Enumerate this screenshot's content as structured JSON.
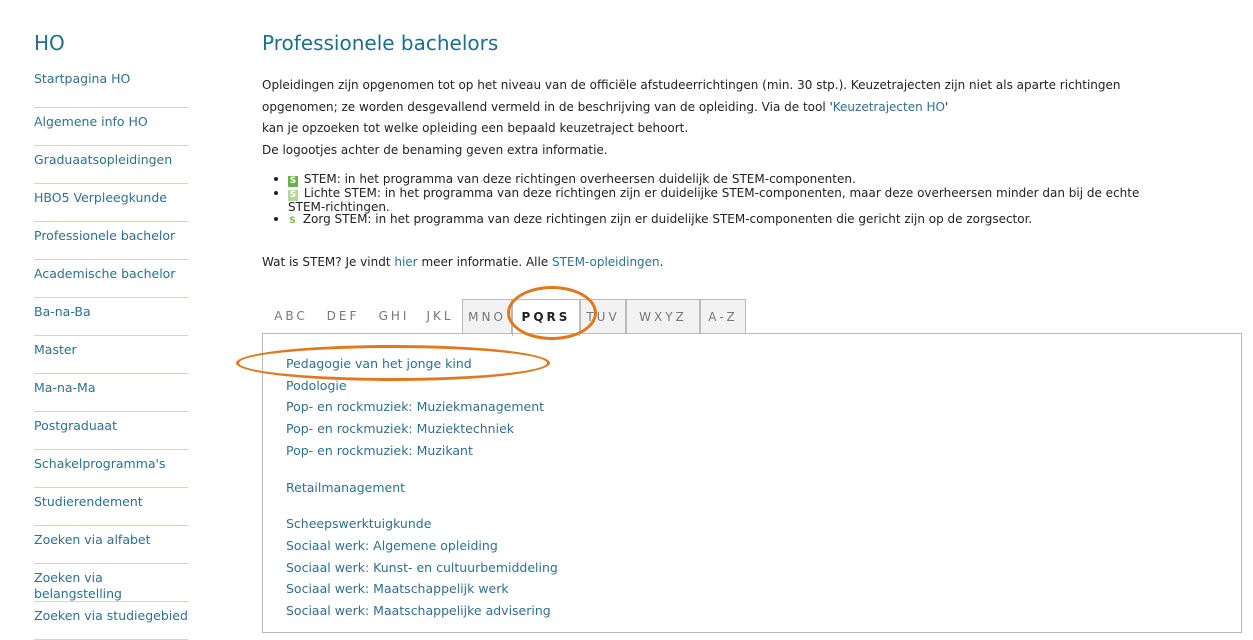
{
  "sidebar": {
    "title": "HO",
    "items": [
      {
        "label": "Startpagina HO"
      },
      {
        "label": "Algemene info HO"
      },
      {
        "label": "Graduaatsopleidingen"
      },
      {
        "label": "HBO5 Verpleegkunde"
      },
      {
        "label": "Professionele bachelor"
      },
      {
        "label": "Academische bachelor"
      },
      {
        "label": "Ba-na-Ba"
      },
      {
        "label": "Master"
      },
      {
        "label": "Ma-na-Ma"
      },
      {
        "label": "Postgraduaat"
      },
      {
        "label": "Schakelprogramma's"
      },
      {
        "label": "Studierendement"
      },
      {
        "label": "Zoeken via alfabet"
      },
      {
        "label": "Zoeken via belangstelling"
      },
      {
        "label": "Zoeken via studiegebied"
      }
    ]
  },
  "main": {
    "title": "Professionele bachelors",
    "intro": {
      "line1": "Opleidingen zijn opgenomen tot op het niveau van de officiële afstudeerrichtingen (min. 30 stp.). Keuzetrajecten zijn niet als aparte richtingen",
      "line2_a": "opgenomen; ze worden desgevallend vermeld in de beschrijving van de opleiding. Via de tool '",
      "line2_link": "Keuzetrajecten HO",
      "line2_b": "'",
      "line3": "kan je opzoeken tot welke opleiding een bepaald keuzetraject behoort.",
      "line4": "De logootjes achter de benaming geven extra informatie."
    },
    "legend": [
      {
        "badge": "S",
        "text": "STEM: in het programma van deze richtingen overheersen duidelijk de STEM-componenten."
      },
      {
        "badge": "S",
        "text": "Lichte STEM: in het programma van deze richtingen zijn er duidelijke STEM-componenten, maar deze overheersen minder dan bij de echte",
        "text2": "STEM-richtingen."
      },
      {
        "badge": "S",
        "text": "Zorg STEM: in het programma van deze richtingen zijn er duidelijke STEM-componenten die gericht zijn op de zorgsector."
      }
    ],
    "stem": {
      "prefix": "Wat is STEM? Je vindt ",
      "link1": "hier",
      "middle": " meer informatie. Alle ",
      "link2": "STEM-opleidingen",
      "suffix": "."
    },
    "tabs": [
      {
        "label": "ABC"
      },
      {
        "label": "DEF"
      },
      {
        "label": "GHI"
      },
      {
        "label": "JKL"
      },
      {
        "label": "MNO"
      },
      {
        "label": "PQRS"
      },
      {
        "label": "TUV"
      },
      {
        "label": "WXYZ"
      },
      {
        "label": "A-Z"
      }
    ],
    "list": {
      "p": [
        "Pedagogie van het jonge kind",
        "Podologie",
        "Pop- en rockmuziek: Muziekmanagement",
        "Pop- en rockmuziek: Muziektechniek",
        "Pop- en rockmuziek: Muzikant"
      ],
      "r": [
        "Retailmanagement"
      ],
      "s": [
        "Scheepswerktuigkunde",
        "Sociaal werk: Algemene opleiding",
        "Sociaal werk: Kunst- en cultuurbemiddeling",
        "Sociaal werk: Maatschappelijk werk",
        "Sociaal werk: Maatschappelijke advisering"
      ]
    }
  },
  "colors": {
    "accent": "#1f6e8c",
    "link": "#2f6f8f",
    "annotation": "#e2781e",
    "stem_green": "#6ab04c"
  }
}
